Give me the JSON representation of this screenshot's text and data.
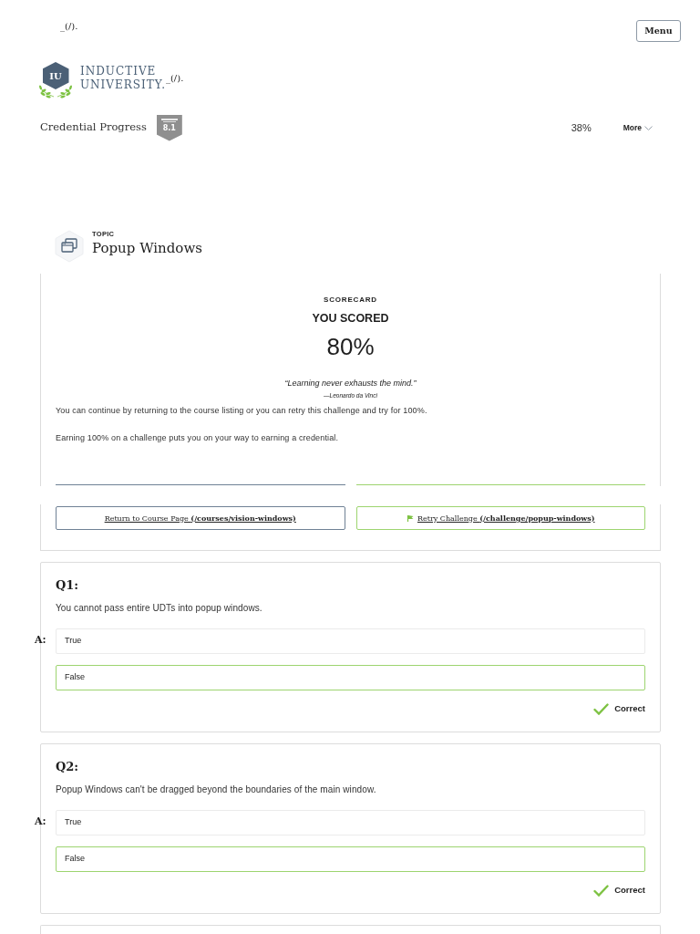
{
  "header": {
    "stray_text": "_(/).",
    "menu_button": "Menu"
  },
  "logo": {
    "mark": "IU",
    "lines": [
      "INDUCTIVE",
      "UNIVERSITY."
    ],
    "trailing_text": "_(/)."
  },
  "credential": {
    "label": "Credential Progress",
    "badge": "8.1",
    "percent": "38%",
    "more": "More"
  },
  "topic": {
    "eyebrow": "TOPIC",
    "title": "Popup Windows"
  },
  "scorecard": {
    "eyebrow": "SCORECARD",
    "heading": "YOU SCORED",
    "score": "80%",
    "quote": "“Learning never exhausts the mind.”",
    "attribution": "—Leonardo da Vinci",
    "paragraphs": [
      "You can continue by returning to the course listing or you can retry this challenge and try for 100%.",
      "Earning 100% on a challenge puts you on your way to earning a credential."
    ],
    "buttons": [
      {
        "kind": "return",
        "label": "Return to Course Page **(/courses/vision-windows)**"
      },
      {
        "kind": "retry",
        "label": "Retry Challenge **(/challenge/popup-windows)**"
      }
    ]
  },
  "questions": [
    {
      "number": "Q1:",
      "text": "You cannot pass entire UDTs into popup windows.",
      "answer_label": "A:",
      "options": [
        {
          "label": "True",
          "selected": false
        },
        {
          "label": "False",
          "selected": true
        }
      ],
      "result": {
        "label": "Correct",
        "correct": true
      }
    },
    {
      "number": "Q2:",
      "text": "Popup Windows can't be dragged beyond the boundaries of the main window.",
      "answer_label": "A:",
      "options": [
        {
          "label": "True",
          "selected": false
        },
        {
          "label": "False",
          "selected": true
        }
      ],
      "result": {
        "label": "Correct",
        "correct": true
      }
    }
  ]
}
